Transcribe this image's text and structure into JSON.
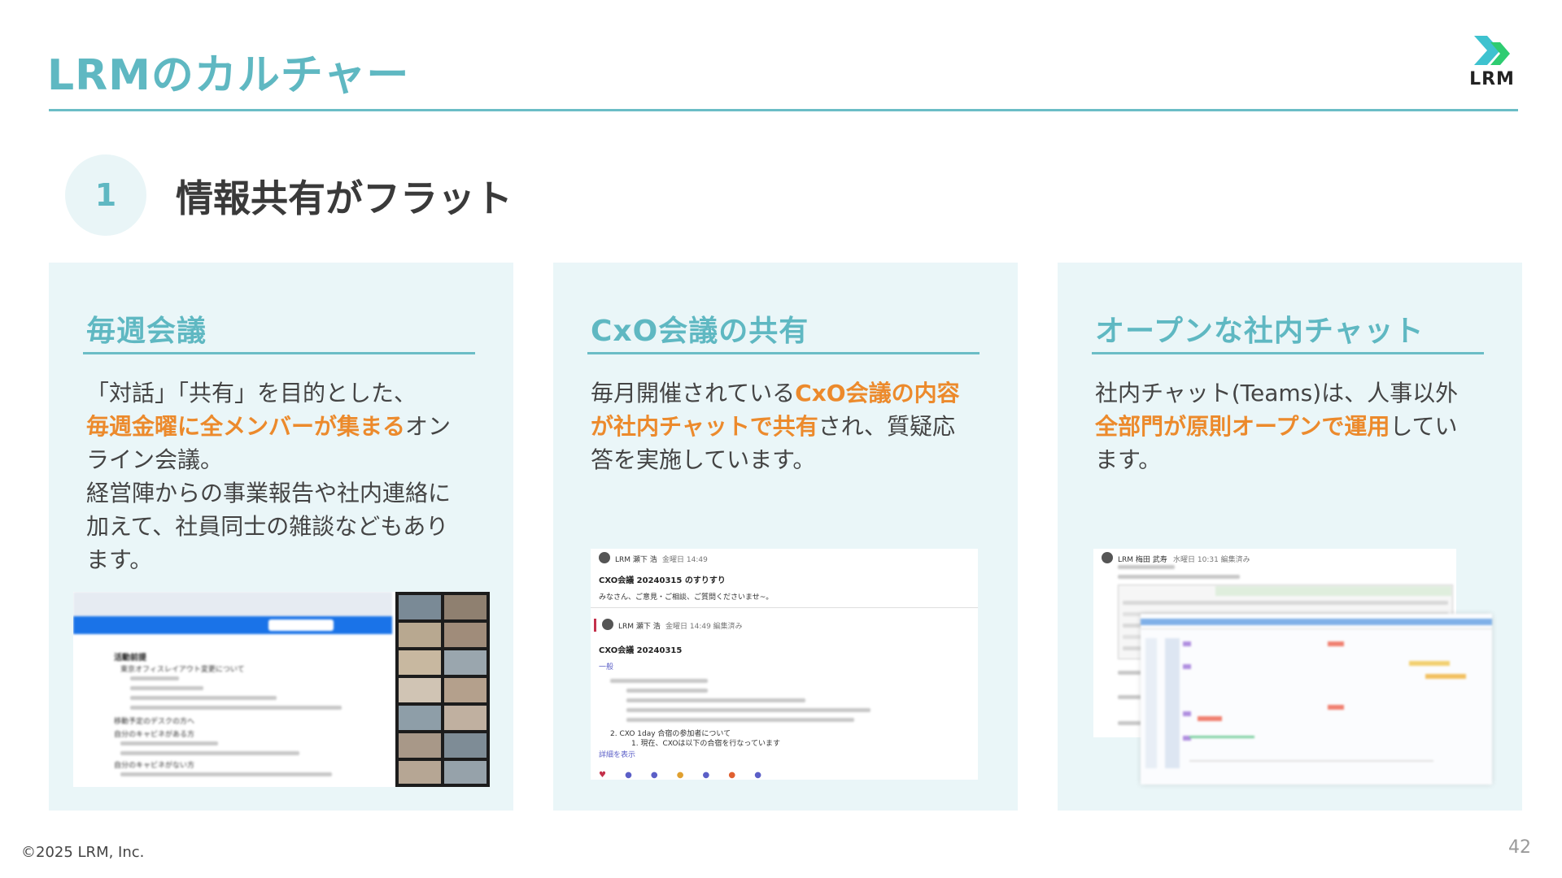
{
  "header": {
    "title": "LRMのカルチャー",
    "logo_text": "LRM"
  },
  "section": {
    "number": "1",
    "title": "情報共有がフラット"
  },
  "cards": [
    {
      "heading": "毎週会議",
      "body_1": "「対話」「共有」を目的とした、",
      "body_highlight": "毎週金曜に全メンバーが集まる",
      "body_2": "オンライン会議。",
      "body_3": "経営陣からの事業報告や社内連絡に加えて、社員同士の雑談などもあります。"
    },
    {
      "heading": "CxO会議の共有",
      "body_1": "毎月開催されている",
      "body_highlight": "CxO会議の内容が社内チャットで共有",
      "body_2": "され、質疑応答を実施しています。",
      "post1_author": "LRM 瀬下 浩",
      "post1_time": "金曜日 14:49",
      "post1_title": "CXO会議 20240315 のすりすり",
      "post1_text": "みなさん、ご意見・ご相談、ご質問くださいませ~。",
      "post2_author": "LRM 瀬下 浩",
      "post2_time": "金曜日 14:49 編集済み",
      "post2_title": "CXO会議 20240315",
      "post2_tag": "一般",
      "post2_item": "2. CXO 1day 合宿の参加者について",
      "post2_sub": "1. 現在、CXOは以下の合宿を行なっています",
      "post2_more": "詳細を表示"
    },
    {
      "heading": "オープンな社内チャット",
      "body_1": "社内チャット(Teams)は、人事以外",
      "body_highlight": "全部門が原則オープンで運用",
      "body_2": "しています。",
      "post_author": "LRM 梅田 武寿",
      "post_time": "水曜日 10:31 編集済み"
    }
  ],
  "meeting_shot": {
    "heading": "活動前提",
    "items": [
      "東京オフィスレイアウト変更について",
      "移動予定のデスクの方へ",
      "自分のキャビネがある方",
      "自分のキャビネがない方"
    ]
  },
  "footer": {
    "copyright": "©2025 LRM, Inc.",
    "page": "42"
  },
  "colors": {
    "accent": "#5fb8c2",
    "highlight": "#ec8a2c",
    "card_bg": "#eaf6f8"
  }
}
